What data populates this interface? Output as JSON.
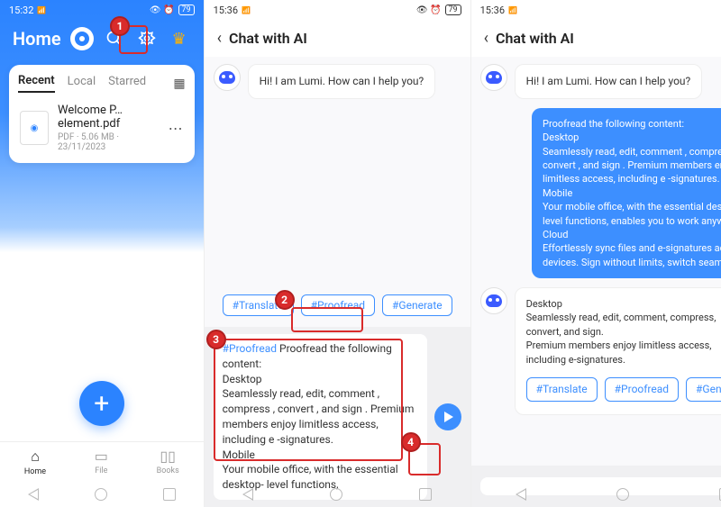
{
  "status": {
    "time1": "15:32",
    "time2": "15:36",
    "time3": "15:36",
    "sig": "📶",
    "battery": "79",
    "icons": "👁 ⏰"
  },
  "panel1": {
    "title": "Home",
    "tabs": {
      "recent": "Recent",
      "local": "Local",
      "starred": "Starred"
    },
    "file": {
      "name": "Welcome P…element.pdf",
      "meta": "PDF · 5.06 MB · 23/11/2023"
    },
    "nav": {
      "home": "Home",
      "file": "File",
      "books": "Books"
    }
  },
  "chat": {
    "title": "Chat with AI",
    "greet": "Hi! I am Lumi. How can I help you?",
    "chips": {
      "translate": "#Translate",
      "proofread": "#Proofread",
      "generate": "#Generate"
    }
  },
  "panel2": {
    "input_cmd": "#Proofread",
    "input_text": " Proofread the following content:\nDesktop\nSeamlessly read, edit, comment , compress , convert , and sign . Premium members enjoy limitless access, including e -signatures.\nMobile\nYour mobile office, with the essential desktop- level functions,"
  },
  "panel3": {
    "user_msg": "Proofread the following content:\nDesktop\nSeamlessly read, edit, comment , compress , convert , and sign . Premium members enjoy limitless access, including e -signatures.\nMobile\nYour mobile office, with the essential desktop- level functions, enables you to work anywhere.\nCloud\nEffortlessly sync files and e-signatures across devices. Sign without limits, switch seamlessly.",
    "ai_resp": "Desktop\nSeamlessly read, edit, comment, compress, convert, and sign.\nPremium members enjoy limitless access, including e-signatures."
  },
  "callouts": {
    "c1": "1",
    "c2": "2",
    "c3": "3",
    "c4": "4"
  }
}
